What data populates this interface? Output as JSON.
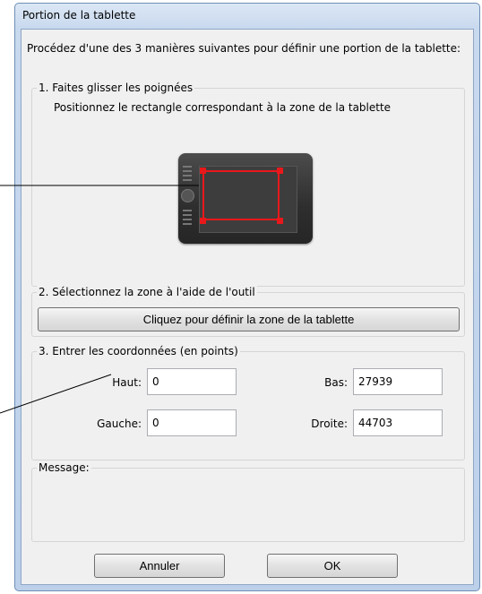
{
  "window": {
    "title": "Portion de la tablette"
  },
  "intro": "Procédez d'une des 3 manières suivantes pour définir une portion de la tablette:",
  "section1": {
    "label": "1. Faites glisser les poignées",
    "subtext": "Positionnez le rectangle correspondant à la zone de la tablette"
  },
  "section2": {
    "label": "2. Sélectionnez la zone à l'aide de l'outil",
    "button_label": "Cliquez pour définir la zone de la tablette"
  },
  "section3": {
    "label": "3. Entrer les coordonnées (en points)",
    "haut_label": "Haut:",
    "haut_value": "0",
    "bas_label": "Bas:",
    "bas_value": "27939",
    "gauche_label": "Gauche:",
    "gauche_value": "0",
    "droite_label": "Droite:",
    "droite_value": "44703"
  },
  "message": {
    "label": "Message:"
  },
  "buttons": {
    "cancel_label": "Annuler",
    "ok_label": "OK"
  },
  "colors": {
    "selection": "#e8181b",
    "tablet": "#2e2e2e"
  }
}
